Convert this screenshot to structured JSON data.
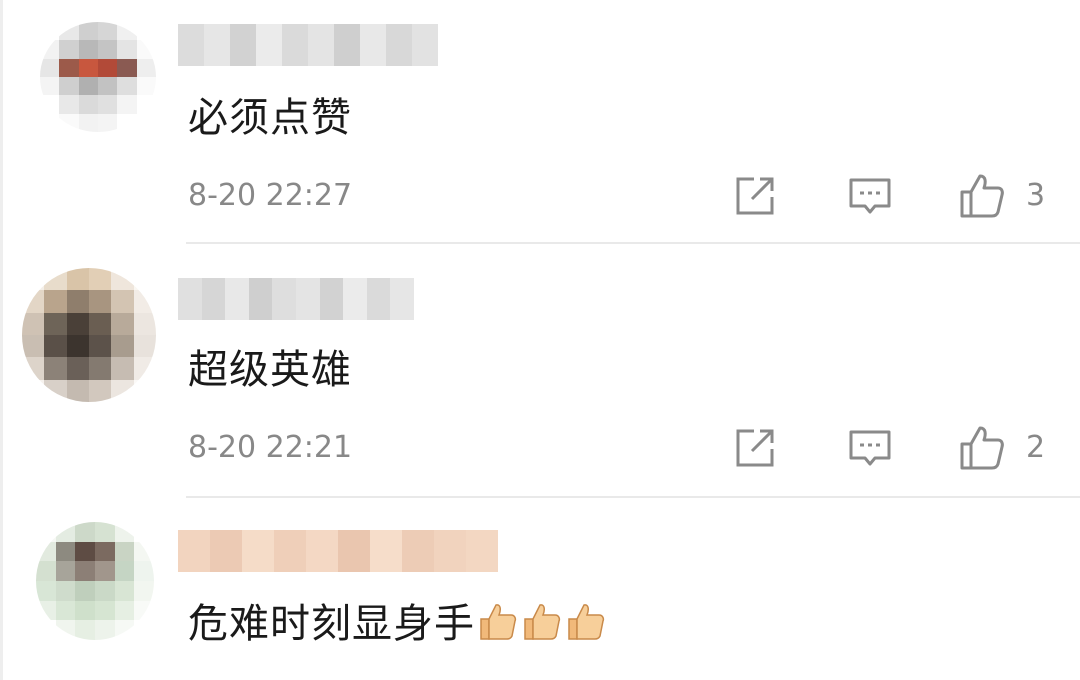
{
  "comments": [
    {
      "text": "必须点赞",
      "time": "8-20 22:27",
      "likes": "3",
      "avatar_colors": [
        "#ffffff",
        "#e8e8e8",
        "#cfcfcf",
        "#d6d6d6",
        "#f0f0f0",
        "#ffffff",
        "#f2f2f2",
        "#d0d0d0",
        "#b8b8b8",
        "#c4c4c4",
        "#e4e4e4",
        "#fafafa",
        "#e6e6e6",
        "#9c5a4a",
        "#c8573e",
        "#b24a38",
        "#8a5a52",
        "#eeeeee",
        "#f4f4f4",
        "#cfcfcf",
        "#b0b0b0",
        "#c2c2c2",
        "#dedede",
        "#fafafa",
        "#ffffff",
        "#e8e8e8",
        "#dadada",
        "#e0e0e0",
        "#f4f4f4",
        "#ffffff",
        "#ffffff",
        "#fafafa",
        "#f2f2f2",
        "#f4f4f4",
        "#ffffff",
        "#ffffff"
      ],
      "username_colors": [
        "#dcdcdc",
        "#e6e6e6",
        "#d2d2d2",
        "#ebebeb",
        "#dadada",
        "#e4e4e4",
        "#cfcfcf",
        "#e8e8e8",
        "#d8d8d8",
        "#e2e2e2"
      ]
    },
    {
      "text": "超级英雄",
      "time": "8-20 22:21",
      "likes": "2",
      "avatar_colors": [
        "#f4efe8",
        "#e8dccb",
        "#d9c4a8",
        "#e2cfb6",
        "#efe6dc",
        "#faf7f2",
        "#e3d6c6",
        "#b9a48c",
        "#8f7e6c",
        "#a89580",
        "#d3c4b2",
        "#f2ece6",
        "#cfc2b4",
        "#6e6458",
        "#4a4038",
        "#6a5e52",
        "#b8aa9a",
        "#ece6e0",
        "#c9beb2",
        "#5a5048",
        "#3c342e",
        "#5c524a",
        "#a89c8e",
        "#e8e2dc",
        "#ddd4ca",
        "#8c8278",
        "#6a6058",
        "#847a70",
        "#c6bcb2",
        "#f0ebe6",
        "#f6f2ee",
        "#d8d0c8",
        "#c4bab0",
        "#d2c8be",
        "#ece6e0",
        "#fbf9f7"
      ],
      "username_colors": [
        "#e0e0e0",
        "#d6d6d6",
        "#e8e8e8",
        "#cfcfcf",
        "#dedede",
        "#e4e4e4",
        "#d2d2d2",
        "#ebebeb",
        "#dadada",
        "#e6e6e6"
      ]
    },
    {
      "text": "危难时刻显身手",
      "emoji_count": 3,
      "avatar_colors": [
        "#f6f8f4",
        "#e4ece2",
        "#cdd9c9",
        "#d6e2d2",
        "#eef3ec",
        "#ffffff",
        "#e2eadf",
        "#8d8a80",
        "#5e4c44",
        "#7b6a60",
        "#c9d4c4",
        "#f4f7f2",
        "#d4e0d0",
        "#a7a49a",
        "#8c7f76",
        "#a1968c",
        "#c5d5c4",
        "#eef4ee",
        "#d8e6d6",
        "#cfdccc",
        "#bfcfbc",
        "#cad9c7",
        "#d8e5d4",
        "#f2f6f0",
        "#e8f0e6",
        "#d9e7d6",
        "#cfe0cb",
        "#d6e5d2",
        "#e6efe3",
        "#f8faf7",
        "#ffffff",
        "#f0f5ee",
        "#e6efe3",
        "#edf3eb",
        "#f6f9f5",
        "#ffffff"
      ],
      "username_colors": [
        "#f2d4bf",
        "#eccab4",
        "#f5dcc8",
        "#efcfb9",
        "#f4d8c4",
        "#eac6af",
        "#f6ddca",
        "#edccb6",
        "#f1d3be",
        "#f3d7c2"
      ]
    }
  ],
  "colors": {
    "text": "#1a1a1a",
    "meta": "#888888",
    "icon": "#8a8a8a",
    "divider": "#e9e9e9"
  }
}
